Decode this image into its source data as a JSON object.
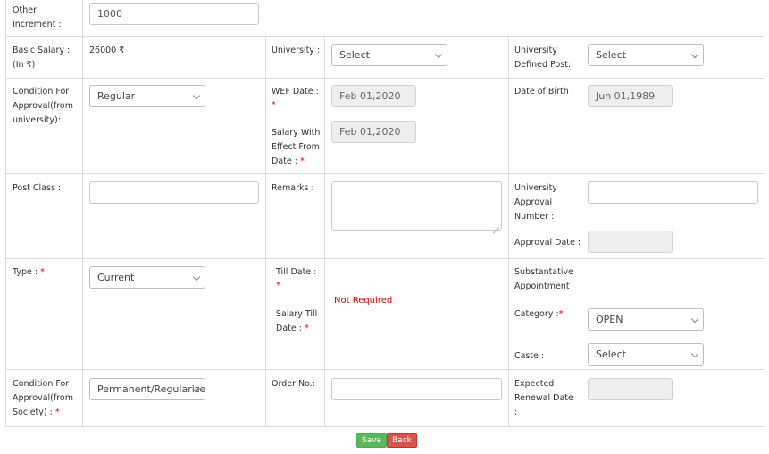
{
  "other_increment": {
    "label": "Other Increment :",
    "value": "1000"
  },
  "basic_salary": {
    "label": "Basic Salary : (In ₹)",
    "value": "26000 ₹"
  },
  "university": {
    "label": "University :",
    "selected": "Select"
  },
  "university_defined_post": {
    "label": "University Defined Post:",
    "selected": "Select"
  },
  "condition_university": {
    "label": "Condition For Approval(from university):",
    "selected": "Regular"
  },
  "wef_date": {
    "label": "WEF Date :",
    "value": "Feb 01,2020"
  },
  "salary_effect_date": {
    "label": "Salary With Effect From Date :",
    "value": "Feb 01,2020"
  },
  "date_of_birth": {
    "label": "Date of Birth :",
    "value": "Jun 01,1989"
  },
  "post_class": {
    "label": "Post Class :",
    "value": ""
  },
  "remarks": {
    "label": "Remarks :",
    "value": ""
  },
  "university_approval_number": {
    "label": "University Approval Number :",
    "value": ""
  },
  "approval_date": {
    "label": "Approval Date :",
    "value": ""
  },
  "type": {
    "label": "Type :",
    "selected": "Current"
  },
  "till_date": {
    "label": "Till Date :"
  },
  "salary_till_date": {
    "label": "Salary Till Date :"
  },
  "not_required": "Not Required",
  "substantative": {
    "label": "Substantative Appointment"
  },
  "category": {
    "label": "Category :",
    "selected": "OPEN"
  },
  "caste": {
    "label": "Caste :",
    "selected": "Select"
  },
  "condition_society": {
    "label": "Condition For Approval(from Society) :",
    "selected": "Permanent/Regularized"
  },
  "order_no": {
    "label": "Order No.:",
    "value": ""
  },
  "expected_renewal_date": {
    "label": "Expected Renewal Date :",
    "value": ""
  },
  "required_marker": "*",
  "buttons": {
    "save": "Save",
    "back": "Back"
  },
  "colors": {
    "save": "#5cb85c",
    "back": "#d9534f",
    "required": "#e00000"
  }
}
